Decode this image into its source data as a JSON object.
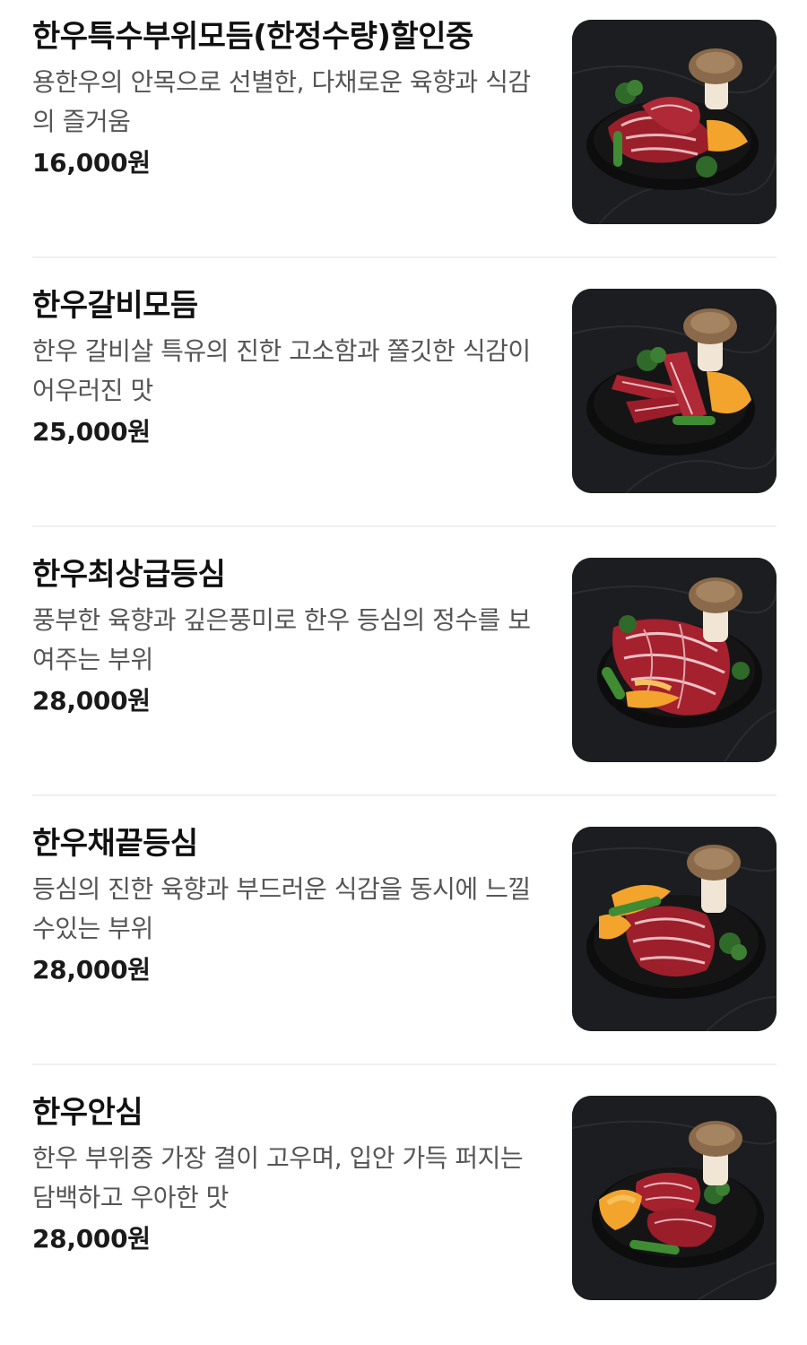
{
  "menu": {
    "items": [
      {
        "name": "한우특수부위모듬(한정수량)할인중",
        "description": "용한우의 안목으로 선별한, 다채로운 육향과 식감의 즐거움",
        "price": "16,000원",
        "image": "marbled-beef-plate-photo"
      },
      {
        "name": "한우갈비모듬",
        "description": "한우 갈비살 특유의 진한 고소함과 쫄깃한 식감이 어우러진 맛",
        "price": "25,000원",
        "image": "rib-strips-plate-photo"
      },
      {
        "name": "한우최상급등심",
        "description": "풍부한 육향과 깊은풍미로 한우 등심의 정수를 보여주는 부위",
        "price": "28,000원",
        "image": "sirloin-plate-photo"
      },
      {
        "name": "한우채끝등심",
        "description": "등심의 진한 육향과 부드러운 식감을 동시에 느낄수있는 부위",
        "price": "28,000원",
        "image": "striploin-plate-photo"
      },
      {
        "name": "한우안심",
        "description": "한우 부위중 가장 결이 고우며, 입안 가득 퍼지는 담백하고 우아한 맛",
        "price": "28,000원",
        "image": "tenderloin-plate-photo"
      }
    ]
  },
  "colors": {
    "background": "#ffffff",
    "title_text": "#111111",
    "description_text": "#555555",
    "divider": "#f0f0f0",
    "photo_background": "#1c1d20"
  }
}
